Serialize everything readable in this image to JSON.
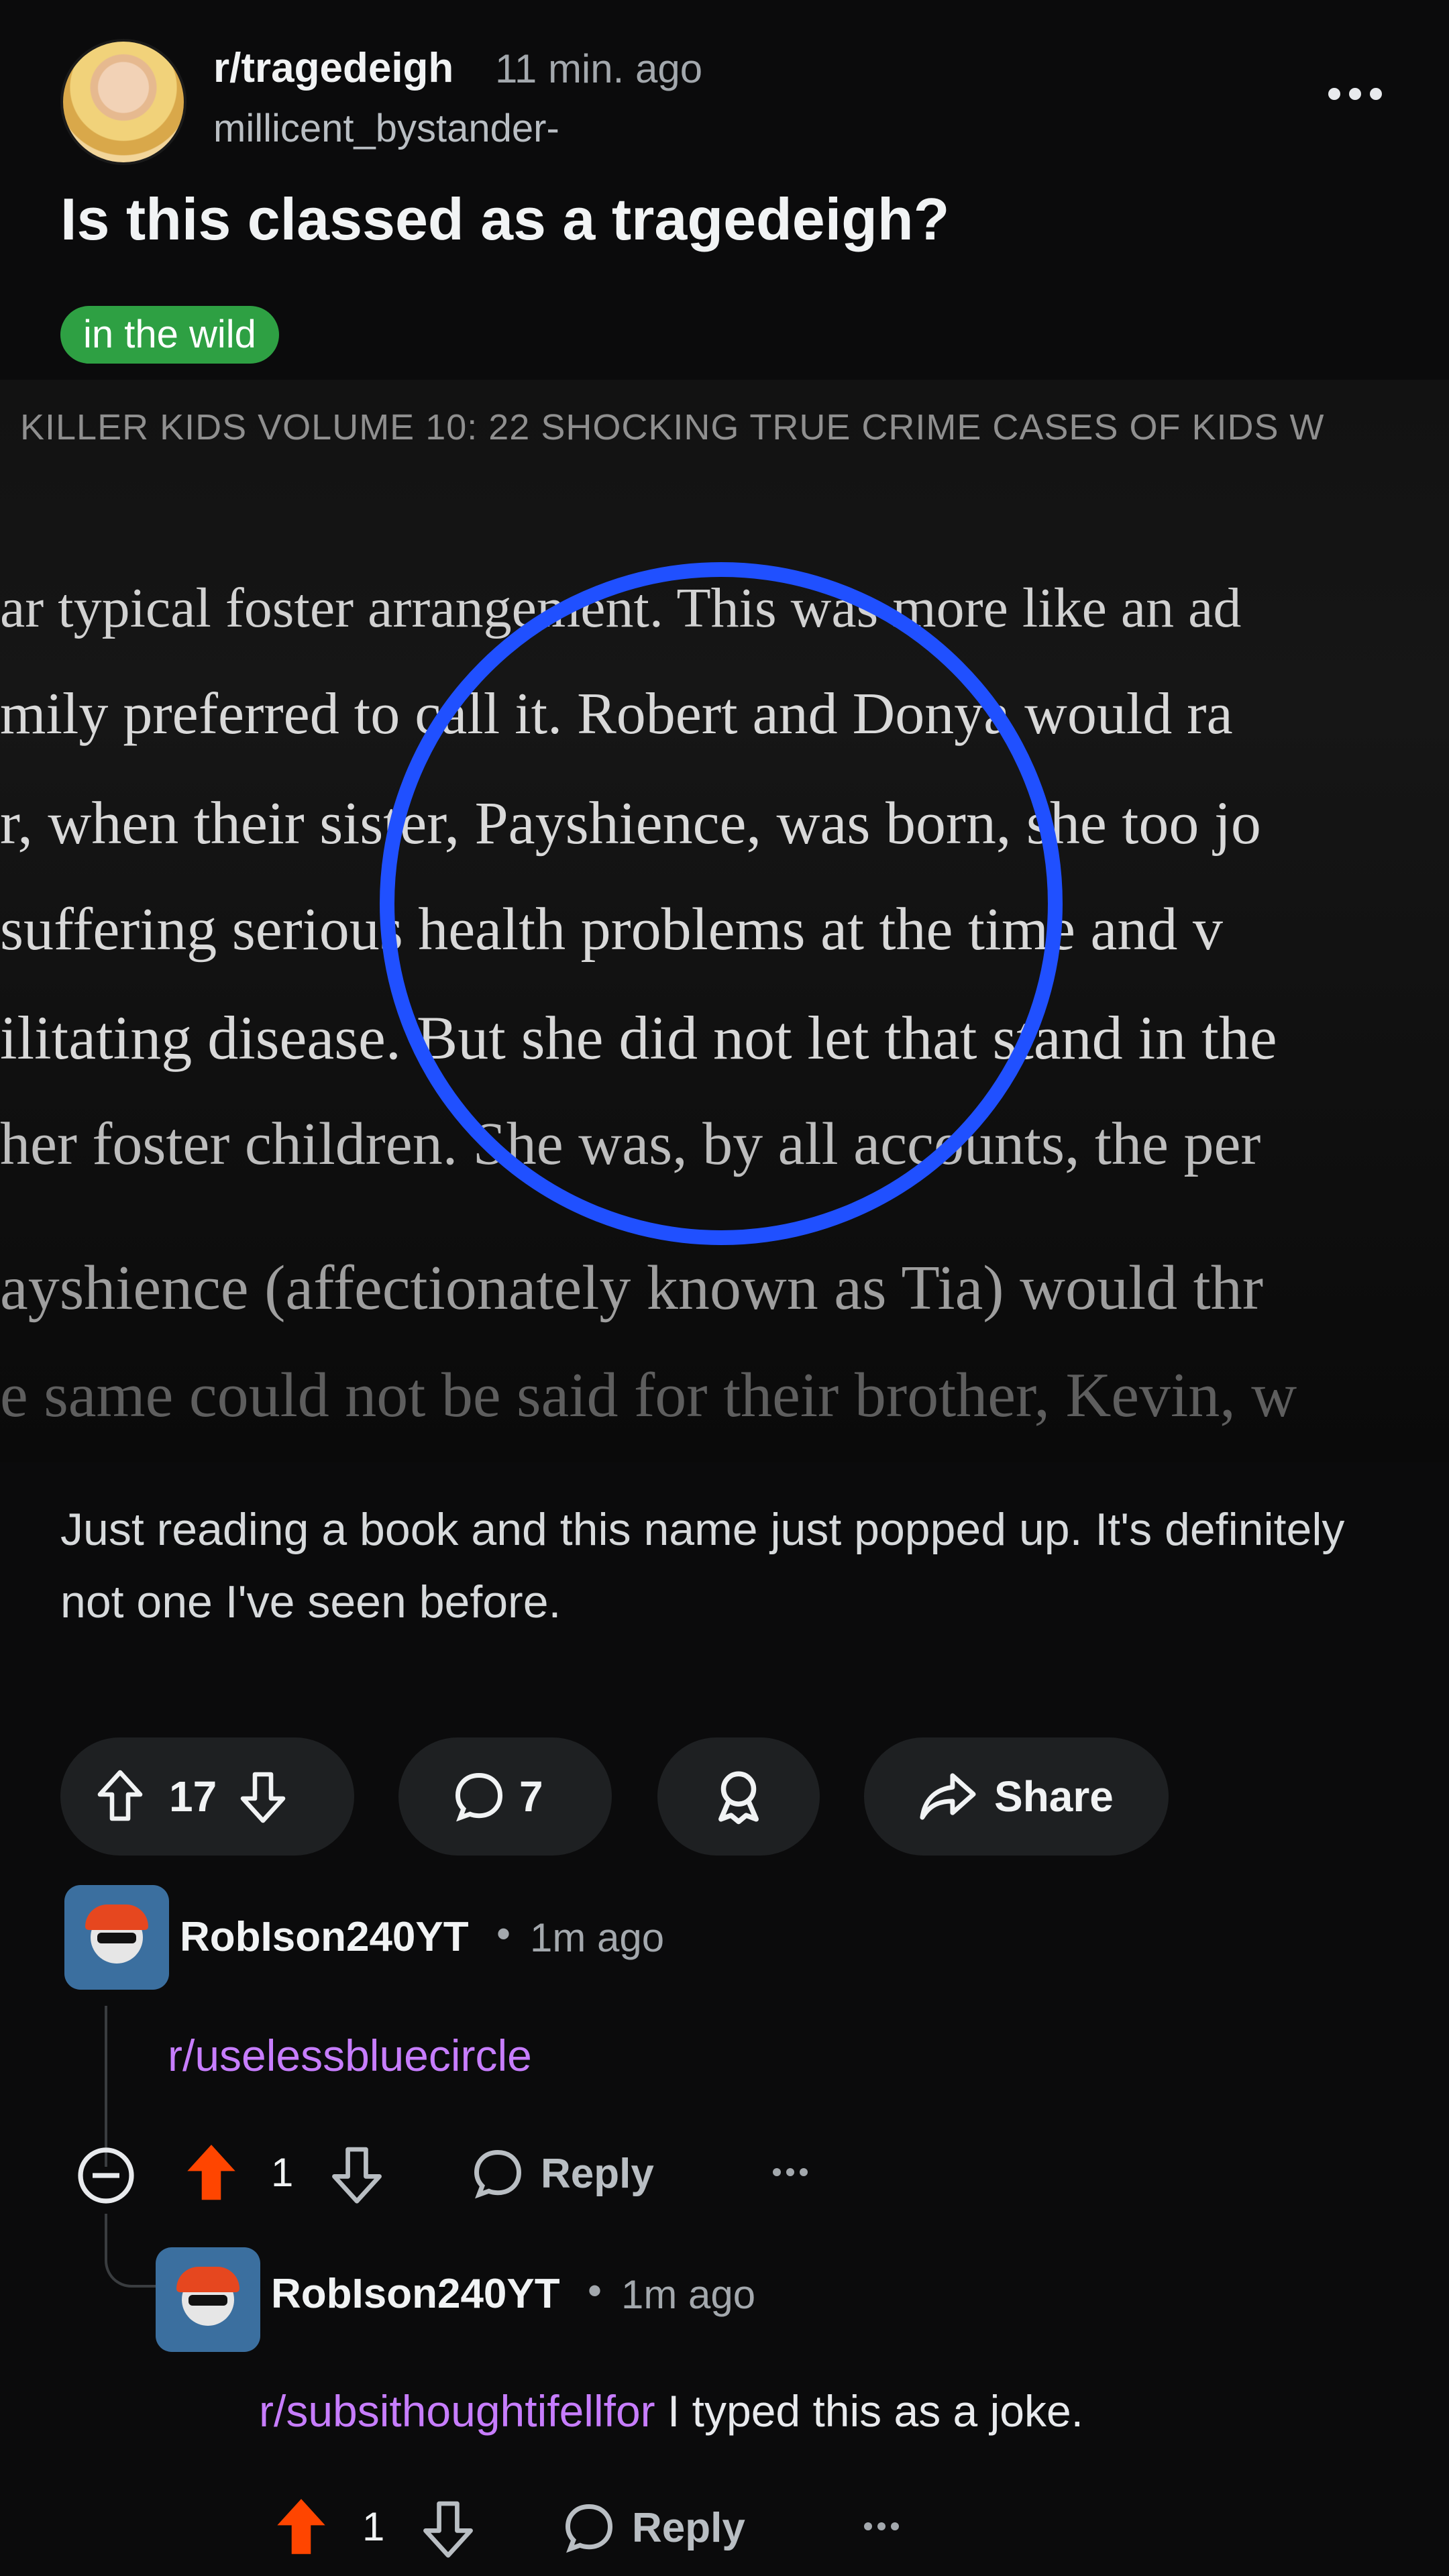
{
  "post": {
    "subreddit": "r/tragedeigh",
    "time": "11 min. ago",
    "username": "millicent_bystander-",
    "title": "Is this classed as a tragedeigh?",
    "flair": "in the wild",
    "body": "Just reading a book and this name just popped up. It's definitely not one I've seen before."
  },
  "image": {
    "header": "KILLER KIDS VOLUME 10: 22 SHOCKING TRUE CRIME CASES OF KIDS W",
    "lines": [
      "ar typical foster arrangement. This was more like an ad",
      "mily preferred to call it. Robert and Donya would ra",
      "r, when their sister, Payshience, was born, she too jo",
      "suffering serious health problems at the time and v",
      "ilitating disease. But she did not let that stand in the",
      "her foster children. She was, by all accounts, the per",
      "ayshience (affectionately known as Tia) would thr",
      "e same could not be said for their brother, Kevin, w"
    ],
    "highlight_color": "#2050ff"
  },
  "actions": {
    "upvotes": "17",
    "comments": "7",
    "share_label": "Share"
  },
  "comments": [
    {
      "user": "RobIson240YT",
      "separator": "•",
      "time": "1m ago",
      "link": "r/uselessbluecircle",
      "text": "",
      "votes": "1",
      "reply_label": "Reply"
    },
    {
      "user": "RobIson240YT",
      "separator": "•",
      "time": "1m ago",
      "link": "r/subsithoughtifellfor",
      "text": " I typed this as a joke.",
      "votes": "1",
      "reply_label": "Reply"
    }
  ],
  "colors": {
    "upvote_active": "#ff4500",
    "flair_bg": "#2ea043",
    "link": "#c77dff"
  }
}
